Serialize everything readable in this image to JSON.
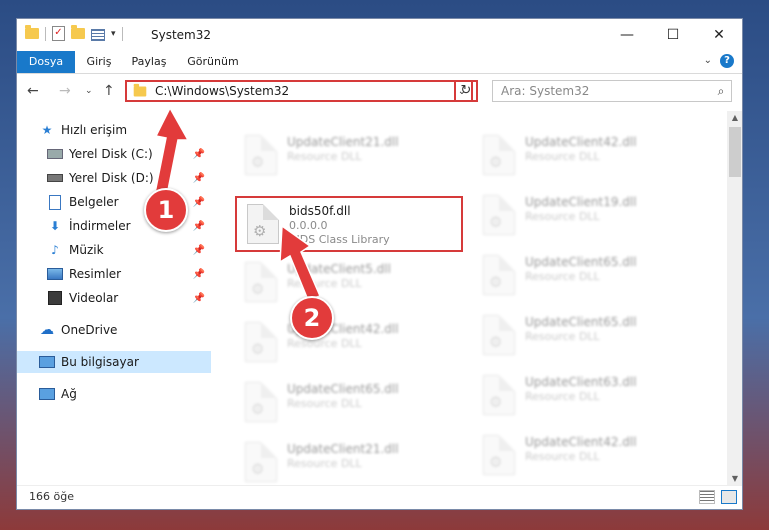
{
  "window": {
    "title": "System32"
  },
  "ribbon": {
    "tabs": [
      "Dosya",
      "Giriş",
      "Paylaş",
      "Görünüm"
    ]
  },
  "nav": {
    "address": "C:\\Windows\\System32",
    "search_placeholder": "Ara: System32"
  },
  "sidebar": {
    "items": [
      {
        "label": "Hızlı erişim",
        "icon": "star-icon"
      },
      {
        "label": "Yerel Disk (C:)",
        "icon": "drive-icon",
        "pinned": true
      },
      {
        "label": "Yerel Disk (D:)",
        "icon": "drive-icon",
        "pinned": true
      },
      {
        "label": "Belgeler",
        "icon": "documents-icon",
        "pinned": true
      },
      {
        "label": "İndirmeler",
        "icon": "download-icon",
        "pinned": true
      },
      {
        "label": "Müzik",
        "icon": "music-icon",
        "pinned": true
      },
      {
        "label": "Resimler",
        "icon": "pictures-icon",
        "pinned": true
      },
      {
        "label": "Videolar",
        "icon": "videos-icon",
        "pinned": true
      },
      {
        "label": "OneDrive",
        "icon": "cloud-icon"
      },
      {
        "label": "Bu bilgisayar",
        "icon": "computer-icon",
        "selected": true
      },
      {
        "label": "Ağ",
        "icon": "network-icon"
      }
    ]
  },
  "files": {
    "highlighted": {
      "name": "bids50f.dll",
      "version": "0.0.0.0",
      "description": "BIDS Class Library"
    },
    "left_column": [
      {
        "name": "UpdateClient21.dll",
        "desc": "Resource DLL"
      },
      {
        "name": "UpdateClient5.dll",
        "desc": "Resource DLL"
      },
      {
        "name": "UpdateClient42.dll",
        "desc": "Resource DLL"
      },
      {
        "name": "UpdateClient65.dll",
        "desc": "Resource DLL"
      },
      {
        "name": "UpdateClient21.dll",
        "desc": "Resource DLL"
      }
    ],
    "right_column": [
      {
        "name": "UpdateClient42.dll",
        "desc": "Resource DLL"
      },
      {
        "name": "UpdateClient19.dll",
        "desc": "Resource DLL"
      },
      {
        "name": "UpdateClient65.dll",
        "desc": "Resource DLL"
      },
      {
        "name": "UpdateClient65.dll",
        "desc": "Resource DLL"
      },
      {
        "name": "UpdateClient63.dll",
        "desc": "Resource DLL"
      },
      {
        "name": "UpdateClient42.dll",
        "desc": "Resource DLL"
      }
    ]
  },
  "status": {
    "count": "166 öğe"
  },
  "annotations": {
    "step1": "1",
    "step2": "2"
  },
  "colors": {
    "accent": "#1979ca",
    "highlight": "#d63a3a",
    "selection": "#cce8ff"
  }
}
